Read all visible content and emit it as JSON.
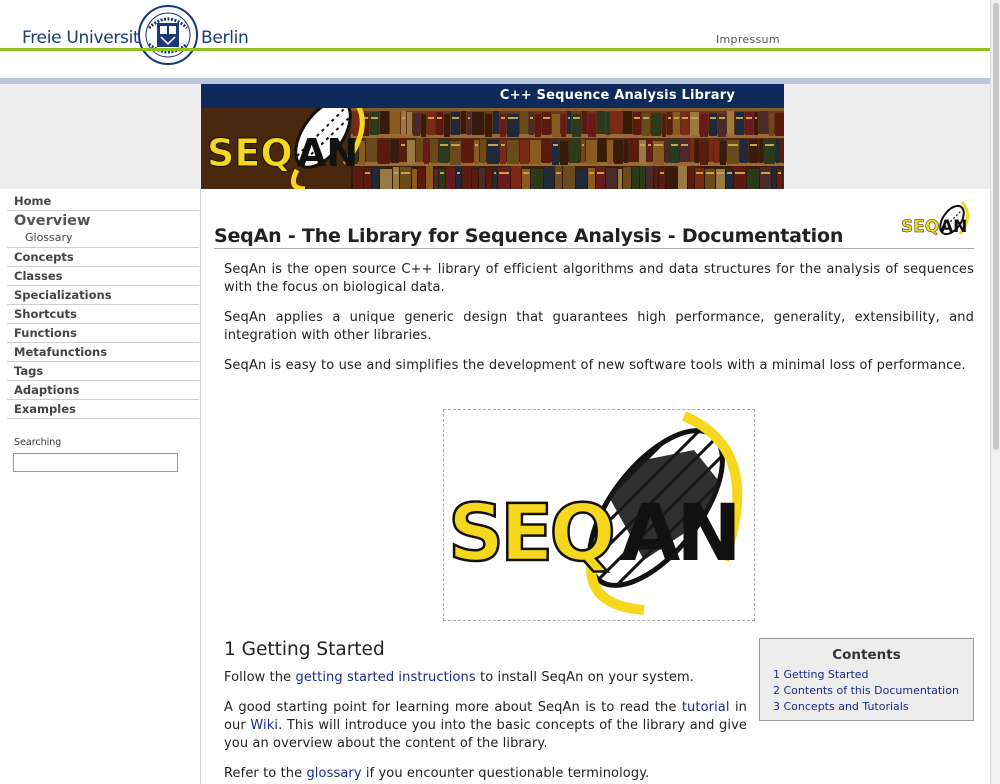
{
  "header": {
    "university_left": "Freie Universität",
    "university_right": "Berlin",
    "impressum": "Impressum"
  },
  "banner": {
    "title": "C++ Sequence Analysis Library",
    "logo_text": "SEQAN"
  },
  "sidebar": {
    "items": [
      {
        "label": "Home"
      },
      {
        "label": "Overview"
      },
      {
        "label": "Glossary"
      },
      {
        "label": "Concepts"
      },
      {
        "label": "Classes"
      },
      {
        "label": "Specializations"
      },
      {
        "label": "Shortcuts"
      },
      {
        "label": "Functions"
      },
      {
        "label": "Metafunctions"
      },
      {
        "label": "Tags"
      },
      {
        "label": "Adaptions"
      },
      {
        "label": "Examples"
      }
    ],
    "search_label": "Searching",
    "search_value": ""
  },
  "main": {
    "title": "SeqAn - The Library for Sequence Analysis - Documentation",
    "paragraphs": [
      "SeqAn is the open source C++ library of efficient algorithms and data structures for the analysis of sequences with the focus on biological data.",
      "SeqAn applies a unique generic design that guarantees high performance, generality, extensibility, and integration with other libraries.",
      "SeqAn is easy to use and simplifies the development of new software tools with a minimal loss of performance."
    ],
    "section1": {
      "heading": "1 Getting Started",
      "p1_before": "Follow the ",
      "p1_link": "getting started instructions",
      "p1_after": " to install SeqAn on your system.",
      "p2_before": "A good starting point for learning more about SeqAn is to read the ",
      "p2_link1": "tutorial",
      "p2_mid": " in our ",
      "p2_link2": "Wiki",
      "p2_after": ". This will introduce you into the basic concepts of the library and give you an overview about the content of the library.",
      "p3_before": "Refer to the ",
      "p3_link": "glossary",
      "p3_after": " if you encounter questionable terminology."
    },
    "toc": {
      "title": "Contents",
      "items": [
        "1 Getting Started",
        "2 Contents of this Documentation",
        "3 Concepts and Tutorials"
      ]
    }
  },
  "colors": {
    "fu_blue": "#1a3a7a",
    "fu_green": "#8ec21f",
    "banner_navy": "#0e2a5c",
    "seqan_yellow": "#f5d71e",
    "link": "#1a2a8a"
  }
}
